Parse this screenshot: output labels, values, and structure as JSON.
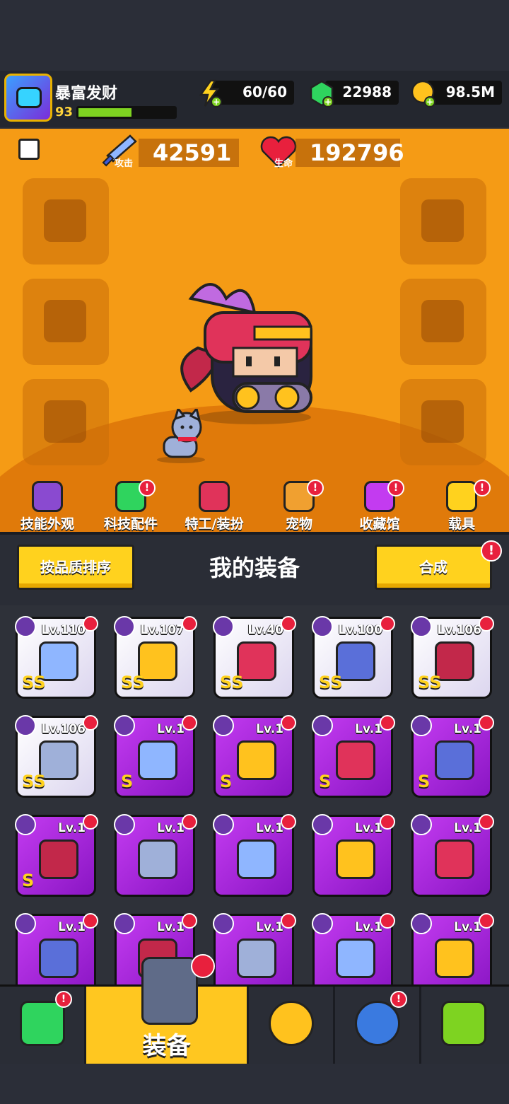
{
  "player": {
    "name": "暴富发财",
    "level": "93",
    "xp_fraction": 0.55
  },
  "resources": [
    {
      "name": "energy",
      "icon": "lightning-icon",
      "value": "60/60"
    },
    {
      "name": "gems",
      "icon": "gem-icon",
      "value": "22988"
    },
    {
      "name": "coins",
      "icon": "coin-icon",
      "value": "98.5M"
    }
  ],
  "stats": {
    "attack": {
      "label": "攻击",
      "value": "42591",
      "icon": "sword-icon"
    },
    "health": {
      "label": "生命",
      "value": "192796",
      "icon": "heart-icon"
    }
  },
  "categories": [
    {
      "label": "技能外观",
      "icon": "skin-icon",
      "badge": false
    },
    {
      "label": "科技配件",
      "icon": "tech-part-icon",
      "badge": true
    },
    {
      "label": "特工/装扮",
      "icon": "agent-icon",
      "badge": false
    },
    {
      "label": "宠物",
      "icon": "pet-icon",
      "badge": true
    },
    {
      "label": "收藏馆",
      "icon": "collection-icon",
      "badge": true
    },
    {
      "label": "载具",
      "icon": "vehicle-icon",
      "badge": true
    }
  ],
  "panel": {
    "sort_label": "按品质排序",
    "title": "我的装备",
    "merge_label": "合成",
    "badge": "!"
  },
  "equipment": [
    {
      "lv": "Lv.110",
      "rarity": "SS",
      "tier": "white",
      "slot": "weapon-icon"
    },
    {
      "lv": "Lv.107",
      "rarity": "SS",
      "tier": "white",
      "slot": "armor-icon"
    },
    {
      "lv": "Lv.40",
      "rarity": "SS",
      "tier": "white",
      "slot": "necklace-icon"
    },
    {
      "lv": "Lv.100",
      "rarity": "SS",
      "tier": "white",
      "slot": "belt-icon"
    },
    {
      "lv": "Lv.106",
      "rarity": "SS",
      "tier": "white",
      "slot": "glove-icon"
    },
    {
      "lv": "Lv.106",
      "rarity": "SS",
      "tier": "white",
      "slot": "boot-icon"
    },
    {
      "lv": "Lv.1",
      "rarity": "S",
      "tier": "purple",
      "slot": "weapon-icon"
    },
    {
      "lv": "Lv.1",
      "rarity": "S",
      "tier": "purple",
      "slot": "weapon-icon"
    },
    {
      "lv": "Lv.1",
      "rarity": "S",
      "tier": "purple",
      "slot": "armor-icon"
    },
    {
      "lv": "Lv.1",
      "rarity": "S",
      "tier": "purple",
      "slot": "belt-icon"
    },
    {
      "lv": "Lv.1",
      "rarity": "S",
      "tier": "purple",
      "slot": "boot-icon"
    },
    {
      "lv": "Lv.1",
      "rarity": "",
      "tier": "purple",
      "slot": "weapon-icon"
    },
    {
      "lv": "Lv.1",
      "rarity": "",
      "tier": "purple",
      "slot": "weapon-icon"
    },
    {
      "lv": "Lv.1",
      "rarity": "",
      "tier": "purple",
      "slot": "weapon-icon"
    },
    {
      "lv": "Lv.1",
      "rarity": "",
      "tier": "purple",
      "slot": "weapon-icon"
    },
    {
      "lv": "Lv.1",
      "rarity": "",
      "tier": "purple",
      "slot": "weapon-icon"
    },
    {
      "lv": "Lv.1",
      "rarity": "",
      "tier": "purple",
      "slot": "weapon-icon"
    },
    {
      "lv": "Lv.1",
      "rarity": "",
      "tier": "purple",
      "slot": "weapon-icon"
    },
    {
      "lv": "Lv.1",
      "rarity": "",
      "tier": "purple",
      "slot": "weapon-icon"
    },
    {
      "lv": "Lv.1",
      "rarity": "",
      "tier": "purple",
      "slot": "weapon-icon"
    }
  ],
  "bottom_tabs": [
    {
      "name": "shop",
      "icon": "shop-icon",
      "label": "",
      "active": false,
      "badge": true
    },
    {
      "name": "equipment",
      "icon": "equipment-bag-icon",
      "label": "装备",
      "active": true,
      "badge": false
    },
    {
      "name": "battle",
      "icon": "crossed-swords-star-icon",
      "label": "",
      "active": false,
      "badge": false
    },
    {
      "name": "events",
      "icon": "star-orb-icon",
      "label": "",
      "active": false,
      "badge": true
    },
    {
      "name": "evolve",
      "icon": "dna-tube-icon",
      "label": "",
      "active": false,
      "badge": false
    }
  ]
}
